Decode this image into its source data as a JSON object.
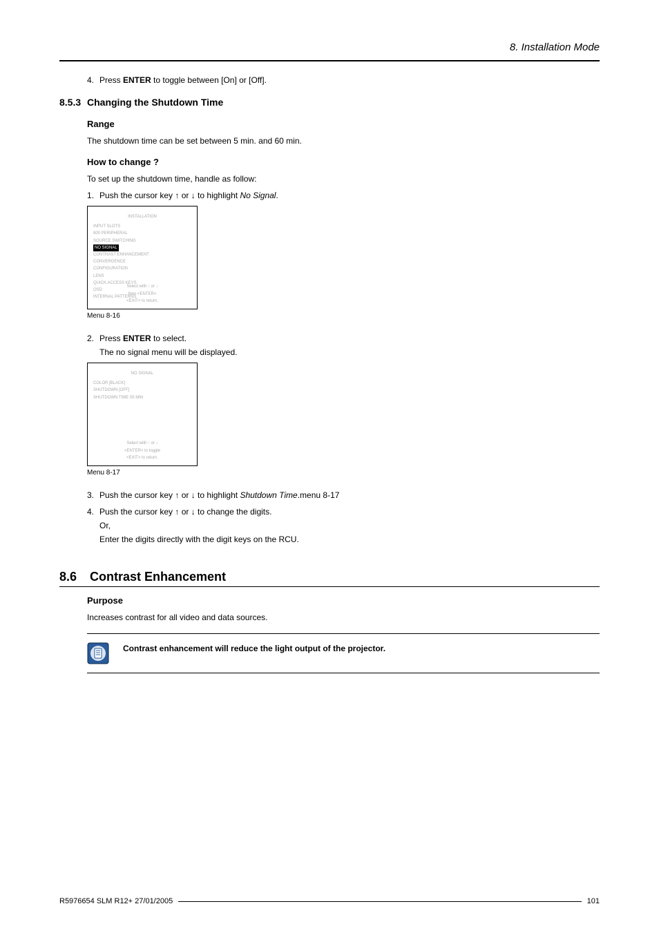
{
  "header": {
    "chapter_title": "8.  Installation Mode"
  },
  "step4_top": {
    "num": "4.",
    "pre": "Press ",
    "bold": "ENTER",
    "post": " to toggle between [On] or [Off]."
  },
  "sec853": {
    "num": "8.5.3",
    "title": "Changing the Shutdown Time",
    "range_h": "Range",
    "range_p": "The shutdown time can be set between 5 min.  and 60 min.",
    "howto_h": "How to change ?",
    "howto_p": "To set up the shutdown time, handle as follow:",
    "step1": {
      "num": "1.",
      "pre": "Push the cursor key ↑ or ↓ to highlight ",
      "italic": "No Signal",
      "post": "."
    },
    "menu816": {
      "title": "INSTALLATION",
      "lines": [
        "INPUT SLOTS",
        "800 PERIPHERAL",
        "SOURCE SWITCHING"
      ],
      "highlight": "NO SIGNAL",
      "lines2": [
        "CONTRAST ENHANCEMENT",
        "CONVERGENCE",
        "CONFIGURATION",
        "LENS",
        "QUICK ACCESS KEYS",
        "OSD",
        "INTERNAL PATTERNS"
      ],
      "footer_top": "Select with  ↑  or  ↓",
      "footer_bot": "then <ENTER>",
      "footer_exit": "<EXIT> to return.",
      "caption": "Menu 8-16"
    },
    "step2": {
      "num": "2.",
      "pre": "Press ",
      "bold": "ENTER",
      "post": " to select.",
      "sub": "The no signal menu will be displayed."
    },
    "menu817": {
      "title": "NO SIGNAL",
      "lines": [
        "COLOR          [BLACK]",
        "SHUTDOWN           [OFF]",
        "SHUTDOWN TIME      05 MIN"
      ],
      "footer_top": "Select with  ↑  or  ↓",
      "footer_bot": "<ENTER> to toggle",
      "footer_exit": "<EXIT> to return.",
      "caption": "Menu 8-17"
    },
    "step3": {
      "num": "3.",
      "pre": "Push the cursor key ↑ or ↓ to highlight ",
      "italic": "Shutdown Time",
      "post": ".menu 8-17"
    },
    "step4": {
      "num": "4.",
      "text": "Push the cursor key ↑ or ↓ to change the digits.",
      "sub1": "Or,",
      "sub2": "Enter the digits directly with the digit keys on the RCU."
    }
  },
  "sec86": {
    "num": "8.6",
    "title": "Contrast Enhancement",
    "purpose_h": "Purpose",
    "purpose_p": "Increases contrast for all video and data sources.",
    "note": "Contrast enhancement will reduce the light output of the projector."
  },
  "footer": {
    "left": "R5976654  SLM R12+  27/01/2005",
    "right": "101"
  }
}
